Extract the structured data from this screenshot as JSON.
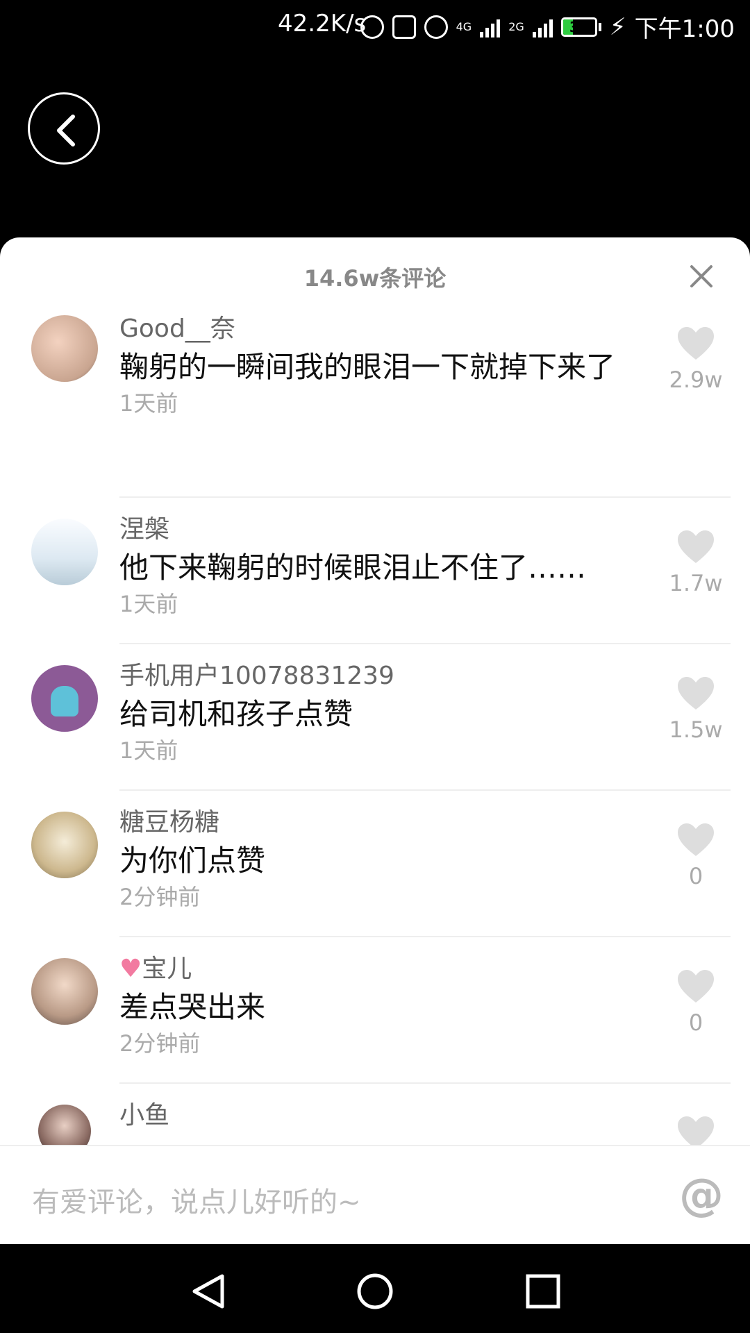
{
  "status_bar": {
    "speed": "42.2K/s",
    "network_4g": "4G",
    "network_2g": "2G",
    "battery": "30",
    "time": "下午1:00"
  },
  "sheet": {
    "title": "14.6w条评论"
  },
  "comments": [
    {
      "username": "Good__奈",
      "text": "鞠躬的一瞬间我的眼泪一下就掉下来了",
      "time": "1天前",
      "likes": "2.9w"
    },
    {
      "username": "涅槃",
      "text": "他下来鞠躬的时候眼泪止不住了……",
      "time": "1天前",
      "likes": "1.7w"
    },
    {
      "username": "手机用户10078831239",
      "text": "给司机和孩子点赞",
      "time": "1天前",
      "likes": "1.5w"
    },
    {
      "username": "糖豆杨糖",
      "text": "为你们点赞",
      "time": "2分钟前",
      "likes": "0"
    },
    {
      "username": "宝儿",
      "text": "差点哭出来",
      "time": "2分钟前",
      "likes": "0"
    },
    {
      "username": "小鱼",
      "text": "",
      "time": "",
      "likes": ""
    }
  ],
  "input": {
    "placeholder": "有爱评论，说点儿好听的~",
    "at_symbol": "@"
  },
  "colors": {
    "like_heart": "#dddddd",
    "battery_fill": "#2ecc40"
  }
}
